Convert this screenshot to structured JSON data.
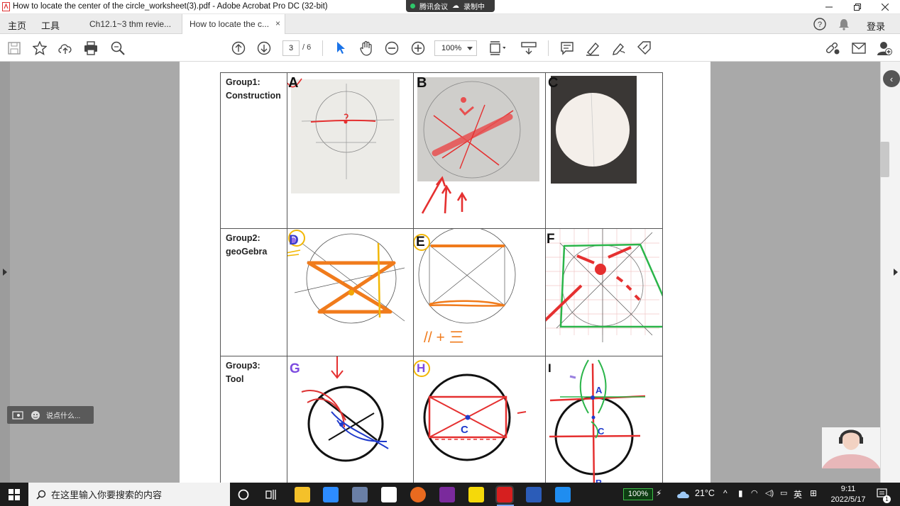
{
  "window": {
    "title": "How to locate the center of the circle_worksheet(3).pdf - Adobe Acrobat Pro DC (32-bit)"
  },
  "meeting_bar": {
    "app": "腾讯会议",
    "recording": "录制中"
  },
  "tabs": {
    "home": "主页",
    "tools": "工具",
    "doc1": "Ch12.1~3 thm revie...",
    "doc2": "How to locate the c...",
    "close": "×",
    "help": "?",
    "login": "登录"
  },
  "toolbar": {
    "page_current": "3",
    "page_total": "/ 6",
    "zoom": "100%"
  },
  "worksheet": {
    "groups": [
      {
        "line1": "Group1:",
        "line2": "Construction"
      },
      {
        "line1": "Group2:",
        "line2": "geoGebra"
      },
      {
        "line1": "Group3:",
        "line2": "Tool"
      }
    ],
    "cell_letters": [
      "A",
      "B",
      "C",
      "D",
      "E",
      "F",
      "G",
      "H",
      "I"
    ],
    "annotations": {
      "e_note": "// + 三",
      "h_center": "C",
      "i_a": "A",
      "i_c": "C",
      "i_b": "B"
    }
  },
  "chat_pill": {
    "placeholder": "说点什么..."
  },
  "taskbar": {
    "search_placeholder": "在这里输入你要搜索的内容",
    "battery": "100%",
    "temperature": "21°C",
    "ime": "英",
    "time": "9:11",
    "date": "2022/5/17",
    "notification_count": "1"
  },
  "colors": {
    "accent_blue": "#1a73e8",
    "annotation_red": "#e53030",
    "geogebra_orange": "#f07b1c",
    "taskbar_bg": "#1c1c1c"
  }
}
